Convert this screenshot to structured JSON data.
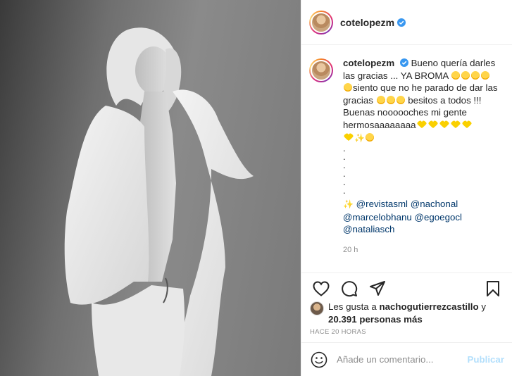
{
  "post": {
    "author": "cotelopezm",
    "caption": {
      "line1": "Bueno quería darles las gracias ... YA BROMA",
      "line2": "siento que no he parado de dar las gracias",
      "line3": "besitos a todos !!! Buenas noooooches mi gente hermosaaaaaaaa",
      "dots": [
        ".",
        ".",
        ".",
        ".",
        ".",
        "."
      ],
      "mentions": [
        "@revistasml",
        "@nachonal",
        "@marcelobhanu",
        "@egoegocl",
        "@nataliasch"
      ]
    },
    "caption_time": "20 h",
    "likes": {
      "prefix": "Les gusta a",
      "user": "nachogutierrezcastillo",
      "conj": "y",
      "count": "20.391 personas más"
    },
    "posted_ago": "HACE 20 HORAS",
    "comment_box": {
      "placeholder": "Añade un comentario...",
      "publish": "Publicar"
    }
  },
  "colors": {
    "text": "#262626",
    "muted": "#8e8e8e",
    "mention": "#00376b",
    "publish_disabled": "#b2dffc",
    "verified": "#3897f0"
  },
  "icons": [
    "verified-badge-icon",
    "heart-icon",
    "comment-icon",
    "share-icon",
    "save-icon",
    "emoji-icon"
  ]
}
